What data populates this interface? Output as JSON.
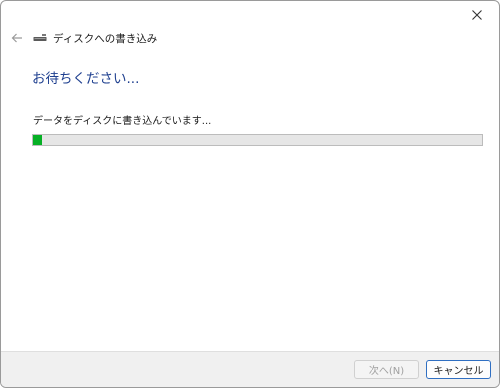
{
  "window": {
    "title": "ディスクへの書き込み",
    "heading": "お待ちください...",
    "status_text": "データをディスクに書き込んでいます...",
    "progress_percent": 2,
    "icons": {
      "close": "close-icon",
      "back": "back-arrow-icon",
      "drive": "disc-drive-icon"
    }
  },
  "buttons": {
    "next_label": "次へ(N)",
    "cancel_label": "キャンセル"
  },
  "colors": {
    "heading": "#1e3f8f",
    "progress_fill": "#06b025",
    "progress_track": "#e6e6e6",
    "cancel_border": "#2f6fc2"
  }
}
